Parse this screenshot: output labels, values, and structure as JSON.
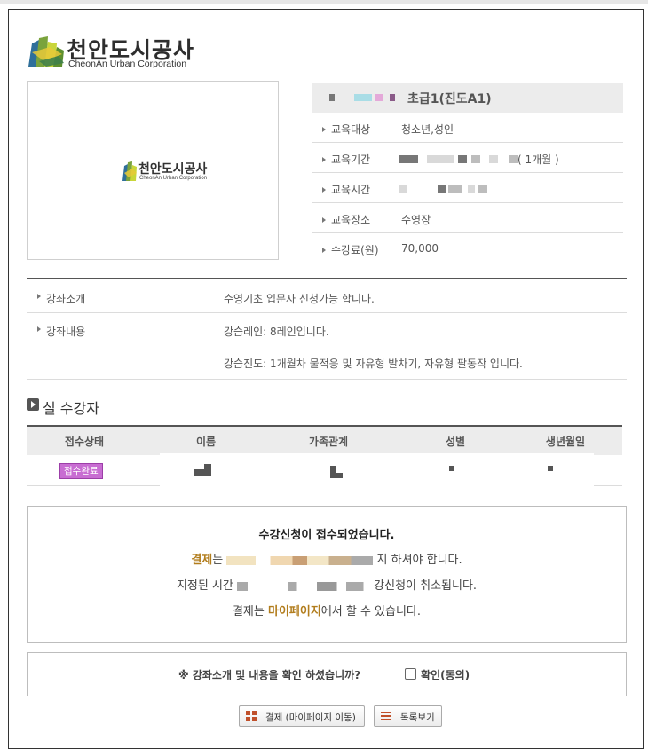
{
  "brand": {
    "name_ko": "천안도시공사",
    "name_en": "CheonAn Urban Corporation"
  },
  "course": {
    "title": "초급1(진도A1)",
    "info": [
      {
        "label": "교육대상",
        "value": "청소년,성인"
      },
      {
        "label": "교육기간",
        "value": "( 1개월 )"
      },
      {
        "label": "교육시간",
        "value": ""
      },
      {
        "label": "교육장소",
        "value": "수영장"
      },
      {
        "label": "수강료(원)",
        "value": "70,000"
      }
    ]
  },
  "intro": {
    "intro_label": "강좌소개",
    "intro_value": "수영기초 입문자 신청가능 합니다.",
    "content_label": "강좌내용",
    "content_value_1": "강습레인: 8레인입니다.",
    "content_value_2": "강습진도: 1개월차 물적응 및 자유형 발차기, 자유형 팔동작 입니다."
  },
  "attendees": {
    "heading": "실 수강자",
    "columns": [
      "접수상태",
      "이름",
      "가족관계",
      "성별",
      "생년월일"
    ],
    "rows": [
      {
        "status": "접수완료"
      }
    ]
  },
  "message": {
    "headline": "수강신청이 접수되었습니다.",
    "payment_word": "결제",
    "line2_a": "는",
    "line2_b": "지 하셔야 합니다.",
    "line3_a": "지정된 시간",
    "line3_b": "강신청이 취소됩니다.",
    "line4_a": "결제는 ",
    "line4_link": "마이페이지",
    "line4_b": "에서 할 수 있습니다."
  },
  "confirm": {
    "question": "※ 강좌소개 및 내용을 확인 하셨습니까?",
    "checkbox_label": "확인(동의)"
  },
  "buttons": {
    "pay": "결제 (마이페이지 이동)",
    "list": "목록보기"
  },
  "colors": {
    "badge": "#c86dd2",
    "highlight": "#b27d1d"
  }
}
